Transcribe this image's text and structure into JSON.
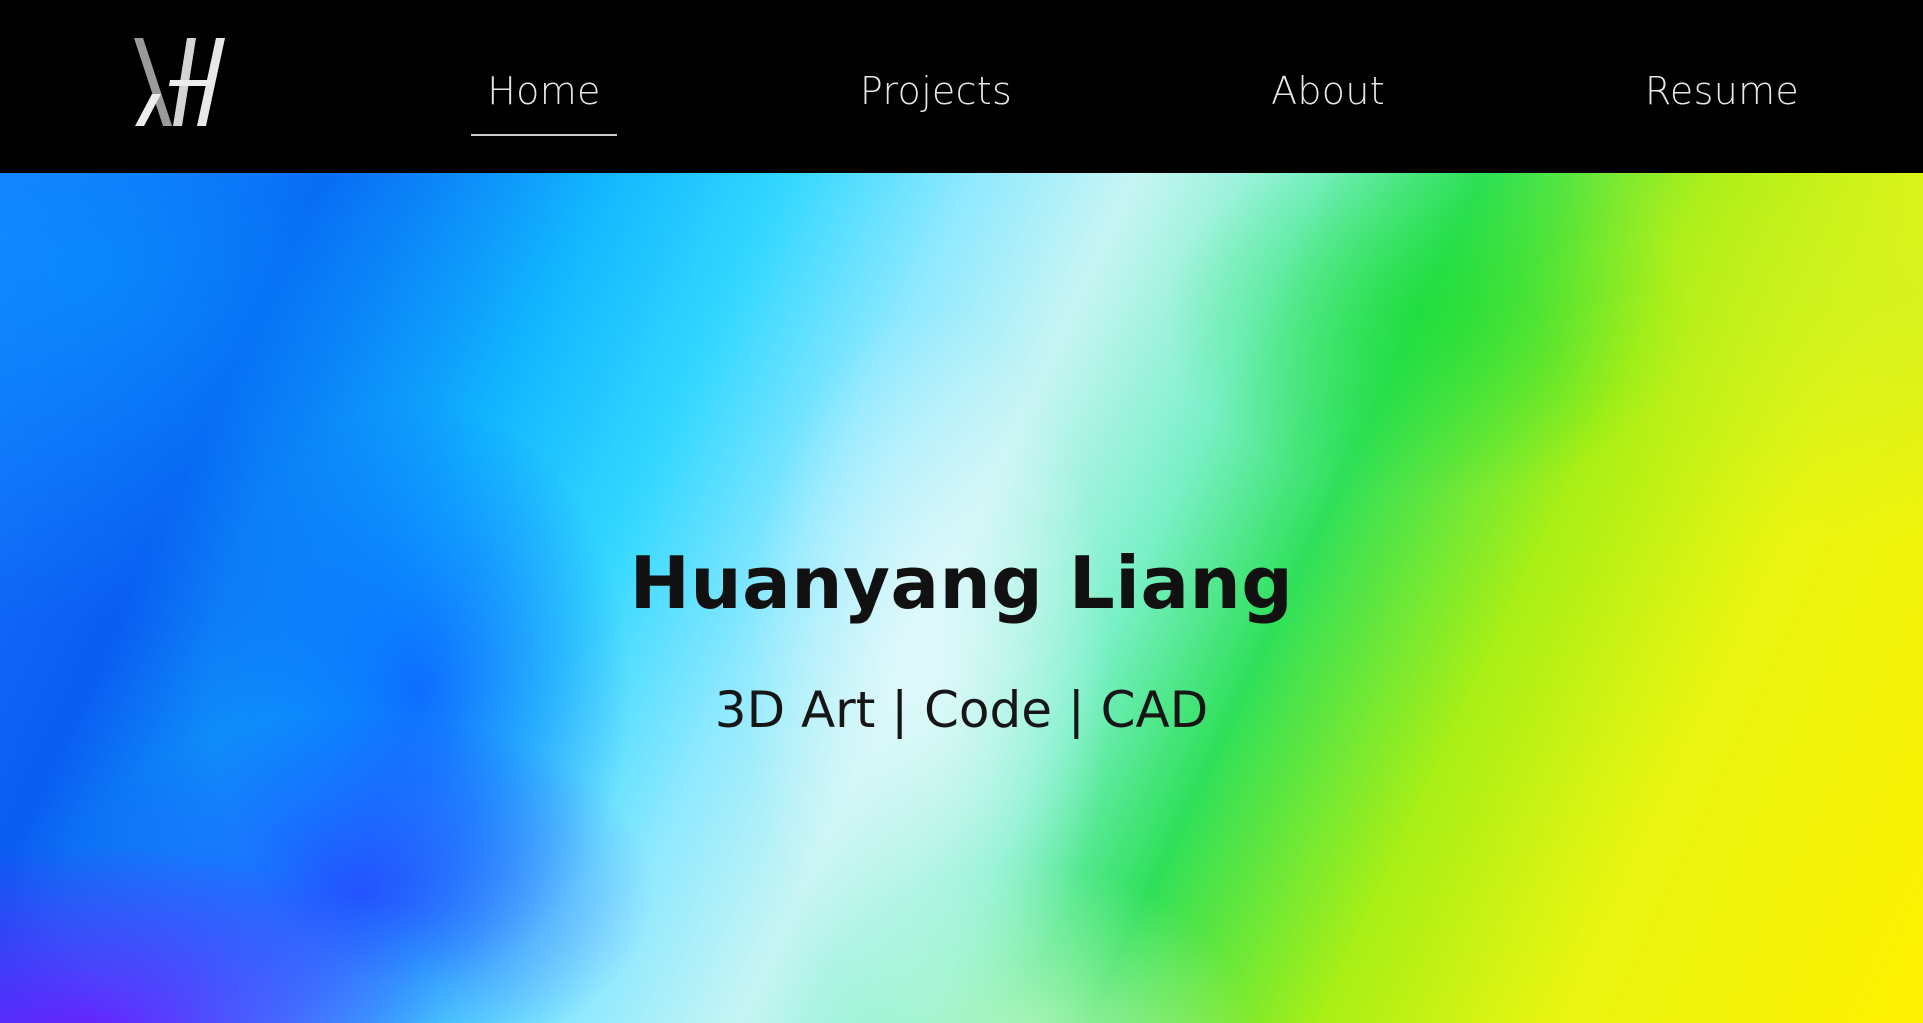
{
  "nav": {
    "logo_name": "hl-monogram-logo",
    "items": [
      {
        "label": "Home",
        "active": true
      },
      {
        "label": "Projects",
        "active": false
      },
      {
        "label": "About",
        "active": false
      },
      {
        "label": "Resume",
        "active": false
      }
    ]
  },
  "hero": {
    "title": "Huanyang Liang",
    "subtitle": "3D Art | Code | CAD"
  },
  "colors": {
    "nav_background": "#000000",
    "nav_text": "#e6e6e6",
    "hero_title": "#111111",
    "hero_gradient": [
      "#0a5cf2",
      "#33d7ff",
      "#c7f5f4",
      "#2fe05a",
      "#fff100"
    ]
  }
}
